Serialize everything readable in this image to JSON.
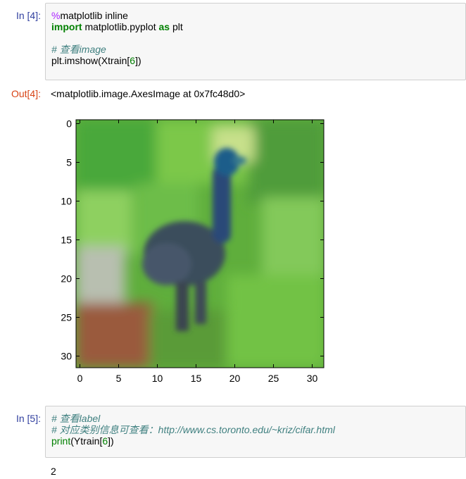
{
  "cell4": {
    "prompt": "In [4]:",
    "line1_magic": "%",
    "line1_rest": "matplotlib inline",
    "line2_kw1": "import",
    "line2_mid": " matplotlib.pyplot ",
    "line2_kw2": "as",
    "line2_end": " plt",
    "line3_comment": "# 查看image",
    "line4_pre": "plt.imshow(Xtrain[",
    "line4_num": "6",
    "line4_post": "])"
  },
  "out4": {
    "prompt": "Out[4]:",
    "text": "<matplotlib.image.AxesImage at 0x7fc48d0>"
  },
  "figure": {
    "yticks": [
      "0",
      "5",
      "10",
      "15",
      "20",
      "25",
      "30"
    ],
    "xticks": [
      "0",
      "5",
      "10",
      "15",
      "20",
      "25",
      "30"
    ]
  },
  "cell5": {
    "prompt": "In [5]:",
    "line1_comment": "# 查看label",
    "line2_comment": "# 对应类别信息可查看：http://www.cs.toronto.edu/~kriz/cifar.html",
    "line3_fn": "print",
    "line3_pre": "(Ytrain[",
    "line3_num": "6",
    "line3_post": "])"
  },
  "out5": {
    "text": "2"
  }
}
